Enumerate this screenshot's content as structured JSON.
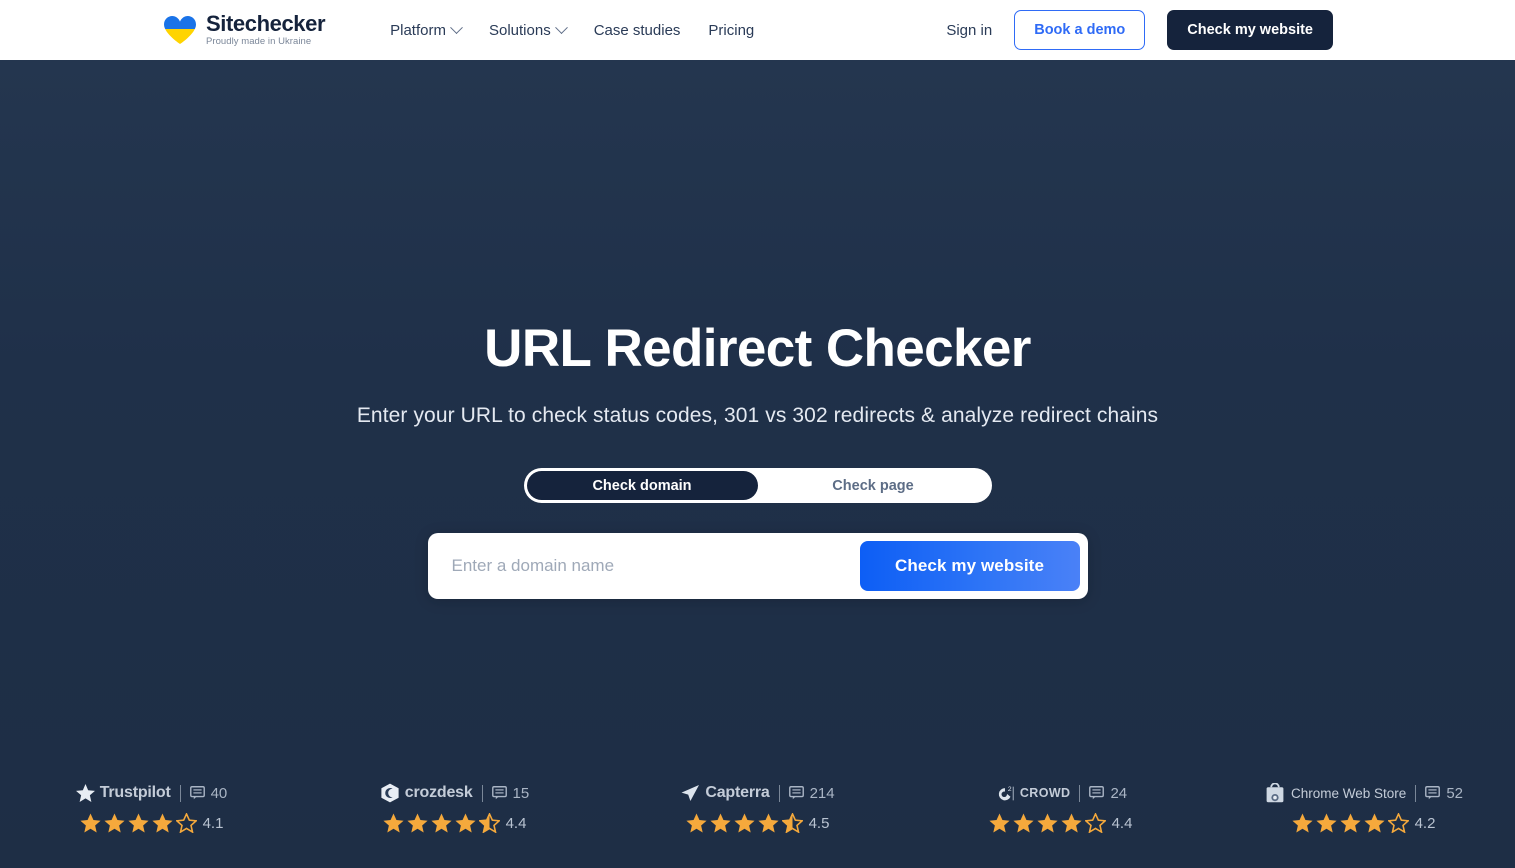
{
  "brand": {
    "name": "Sitechecker",
    "tagline": "Proudly made in Ukraine",
    "logo_icon": "ukraine-heart-logo",
    "colors": {
      "heart_top": "#1a73e8",
      "heart_bottom": "#ffd400"
    }
  },
  "header": {
    "nav": [
      {
        "label": "Platform",
        "has_dropdown": true
      },
      {
        "label": "Solutions",
        "has_dropdown": true
      },
      {
        "label": "Case studies",
        "has_dropdown": false
      },
      {
        "label": "Pricing",
        "has_dropdown": false
      }
    ],
    "sign_in_label": "Sign in",
    "book_demo_label": "Book a demo",
    "check_website_label": "Check my website"
  },
  "hero": {
    "title": "URL Redirect Checker",
    "subtitle": "Enter your URL to check status codes, 301 vs 302 redirects & analyze redirect chains",
    "toggle": {
      "options": [
        {
          "label": "Check domain",
          "active": true
        },
        {
          "label": "Check page",
          "active": false
        }
      ]
    },
    "search": {
      "placeholder": "Enter a domain name",
      "value": "",
      "submit_label": "Check my website"
    },
    "background_color": "#20314a"
  },
  "reviews": [
    {
      "platform": "Trustpilot",
      "logo_icon": "trustpilot-star-icon",
      "review_count": "40",
      "score": "4.1",
      "full_stars": 4,
      "half_star": false
    },
    {
      "platform": "crozdesk",
      "logo_icon": "crozdesk-icon",
      "review_count": "15",
      "score": "4.4",
      "full_stars": 4,
      "half_star": true
    },
    {
      "platform": "Capterra",
      "logo_icon": "capterra-arrow-icon",
      "review_count": "214",
      "score": "4.5",
      "full_stars": 4,
      "half_star": true
    },
    {
      "platform": "CROWD",
      "logo_icon": "g2-crowd-icon",
      "review_count": "24",
      "score": "4.4",
      "full_stars": 4,
      "half_star": false
    },
    {
      "platform": "Chrome Web Store",
      "logo_icon": "chrome-web-store-icon",
      "review_count": "52",
      "score": "4.2",
      "full_stars": 4,
      "half_star": false
    }
  ],
  "colors": {
    "accent_blue": "#2f6bf6",
    "dark_navy": "#15233c",
    "star_amber": "#f5a93c"
  }
}
